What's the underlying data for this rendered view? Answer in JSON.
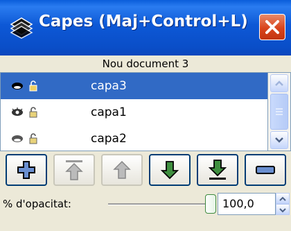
{
  "window": {
    "title": "Capes (Maj+Control+L)",
    "title_icon": "layers-icon",
    "close_icon": "close-icon"
  },
  "document": {
    "name": "Nou document 3"
  },
  "layers": [
    {
      "name": "capa3",
      "selected": true,
      "visible": true,
      "locked": false
    },
    {
      "name": "capa1",
      "selected": false,
      "visible": true,
      "locked": false
    },
    {
      "name": "capa2",
      "selected": false,
      "visible": true,
      "locked": false
    }
  ],
  "toolbar": {
    "buttons": [
      {
        "icon": "add-layer-icon",
        "enabled": true
      },
      {
        "icon": "raise-to-top-icon",
        "enabled": false
      },
      {
        "icon": "raise-layer-icon",
        "enabled": false
      },
      {
        "icon": "lower-layer-icon",
        "enabled": true
      },
      {
        "icon": "lower-to-bottom-icon",
        "enabled": true
      },
      {
        "icon": "remove-layer-icon",
        "enabled": true
      }
    ]
  },
  "opacity": {
    "label": "% d'opacitat:",
    "value": "100,0",
    "fraction": 1.0
  },
  "colors": {
    "titlebar": "#0a58d6",
    "selection": "#316ac5",
    "button_border": "#003c74"
  }
}
